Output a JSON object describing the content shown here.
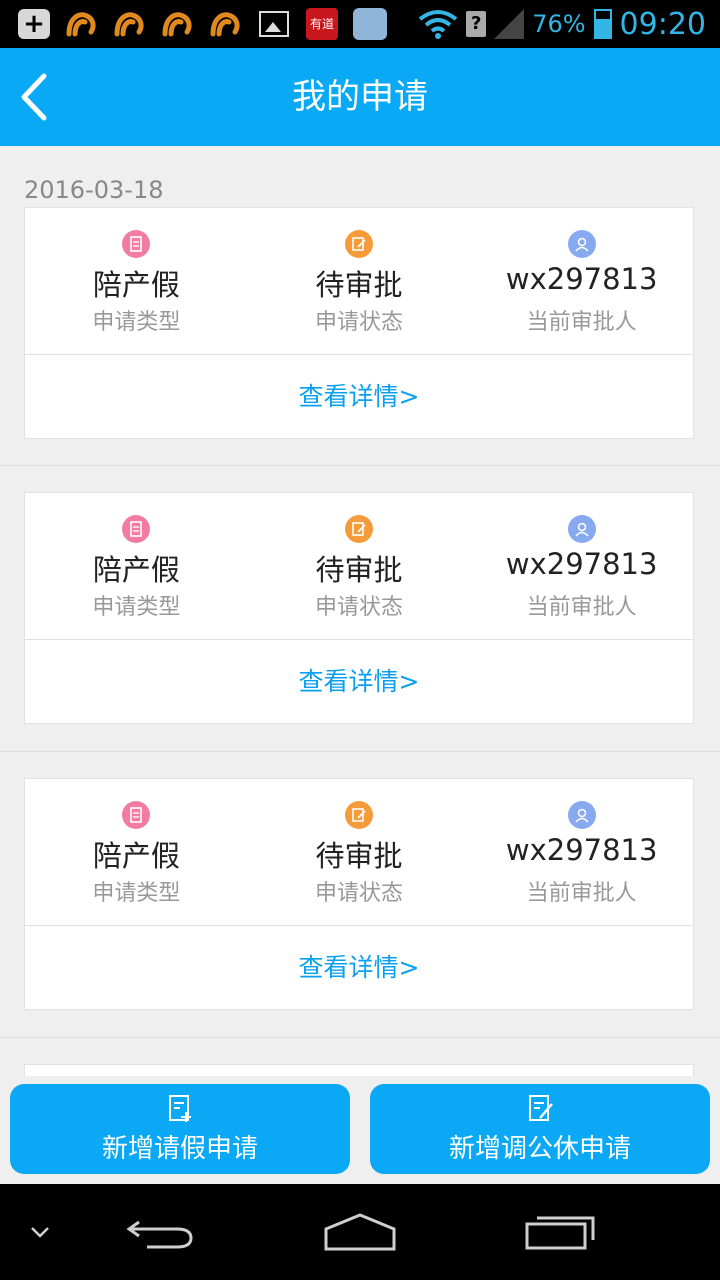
{
  "status_bar": {
    "battery_percent": "76%",
    "time": "09:20",
    "youdao_label": "有道",
    "icons": [
      "add-icon",
      "uc-browser-icon",
      "uc-browser-icon",
      "uc-browser-icon",
      "uc-browser-icon",
      "gallery-icon",
      "youdao-icon",
      "cloud-voice-icon",
      "wifi-icon",
      "sim-icon",
      "signal-icon",
      "battery-icon"
    ]
  },
  "header": {
    "title": "我的申请",
    "back_icon": "chevron-left-icon"
  },
  "list": {
    "date": "2016-03-18",
    "cards": [
      {
        "type_value": "陪产假",
        "type_label": "申请类型",
        "status_value": "待审批",
        "status_label": "申请状态",
        "approver_value": "wx297813",
        "approver_label": "当前审批人",
        "detail_link": "查看详情>"
      },
      {
        "type_value": "陪产假",
        "type_label": "申请类型",
        "status_value": "待审批",
        "status_label": "申请状态",
        "approver_value": "wx297813",
        "approver_label": "当前审批人",
        "detail_link": "查看详情>"
      },
      {
        "type_value": "陪产假",
        "type_label": "申请类型",
        "status_value": "待审批",
        "status_label": "申请状态",
        "approver_value": "wx297813",
        "approver_label": "当前审批人",
        "detail_link": "查看详情>"
      }
    ]
  },
  "actions": {
    "new_leave": "新增请假申请",
    "new_timeoff": "新增调公休申请"
  },
  "colors": {
    "accent": "#09a9f5",
    "type_icon": "#f27ba4",
    "status_icon": "#f59b3a",
    "approver_icon": "#86a9f0"
  }
}
